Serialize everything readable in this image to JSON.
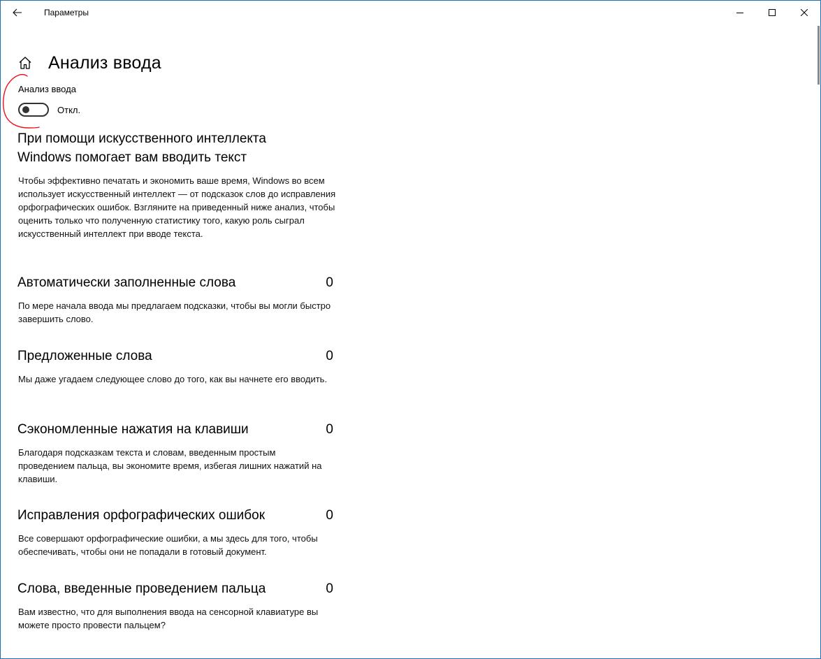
{
  "window": {
    "title": "Параметры"
  },
  "header": {
    "title": "Анализ ввода"
  },
  "toggle": {
    "label": "Анализ ввода",
    "state": "Откл."
  },
  "intro": {
    "heading": "При помощи искусственного интеллекта Windows помогает вам вводить текст",
    "description": "Чтобы эффективно печатать и экономить ваше время, Windows во всем использует искусственный интеллект — от подсказок слов до исправления орфографических ошибок. Взгляните на приведенный ниже анализ, чтобы оценить только что полученную статистику того, какую роль сыграл искусственный интеллект при вводе текста."
  },
  "stats": [
    {
      "title": "Автоматически заполненные слова",
      "value": "0",
      "description": "По мере начала ввода мы предлагаем подсказки, чтобы вы могли быстро завершить слово."
    },
    {
      "title": "Предложенные слова",
      "value": "0",
      "description": "Мы даже угадаем следующее слово до того, как вы начнете его вводить."
    },
    {
      "title": "Сэкономленные нажатия на клавиши",
      "value": "0",
      "description": "Благодаря подсказкам текста и словам, введенным простым проведением пальца, вы экономите время, избегая лишних нажатий на клавиши."
    },
    {
      "title": "Исправления орфографических ошибок",
      "value": "0",
      "description": "Все совершают орфографические ошибки, а мы здесь для того, чтобы обеспечивать, чтобы они не попадали в готовый документ."
    },
    {
      "title": "Слова, введенные проведением пальца",
      "value": "0",
      "description": "Вам известно, что для выполнения ввода на сенсорной клавиатуре вы можете просто провести пальцем?"
    }
  ],
  "colors": {
    "window_border": "#1f6fb5",
    "annotation": "#e8141e",
    "toggle": "#333333"
  },
  "icons": [
    "back-arrow-icon",
    "minimize-icon",
    "maximize-icon",
    "close-icon",
    "home-icon"
  ]
}
